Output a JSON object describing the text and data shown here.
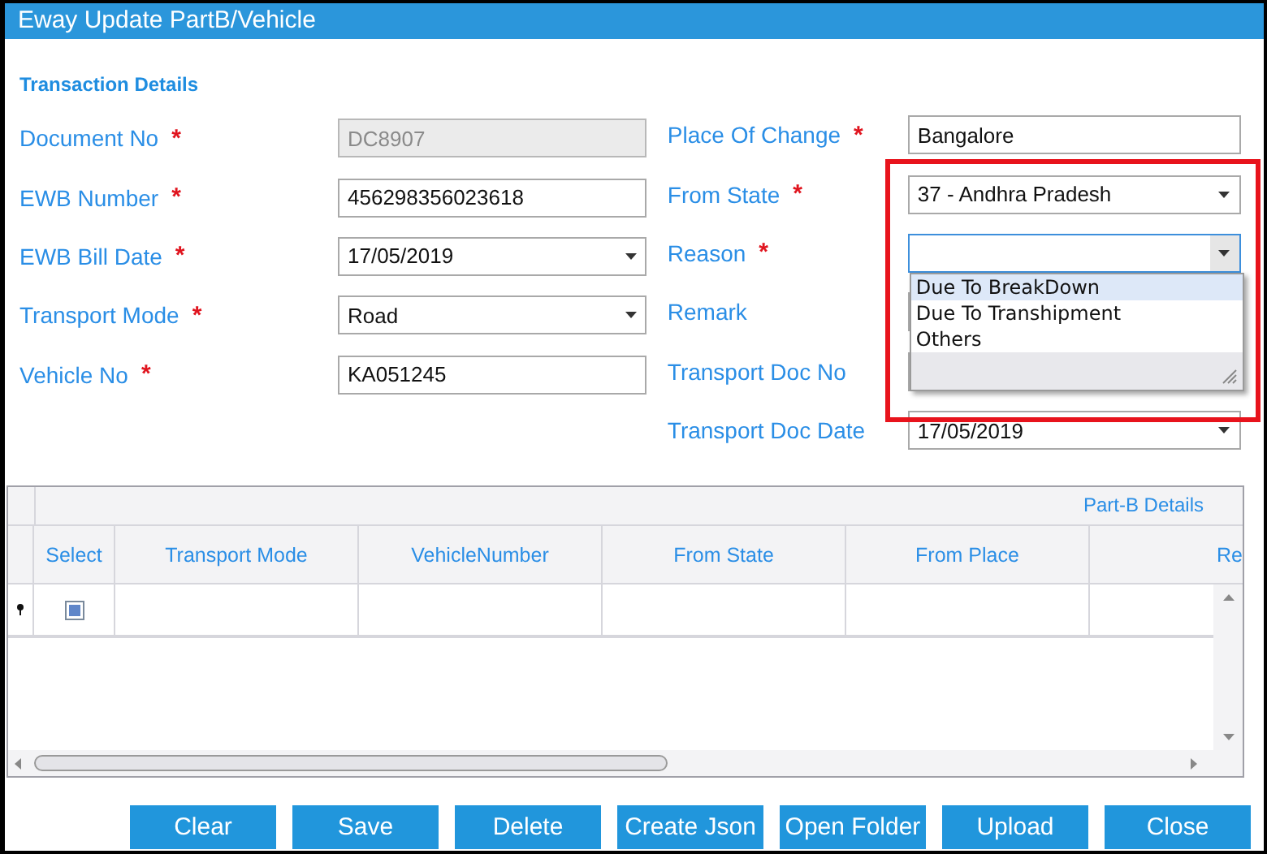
{
  "window": {
    "title": "Eway Update PartB/Vehicle"
  },
  "section_title": "Transaction Details",
  "fields_left": [
    {
      "label": "Document No",
      "required_mark": "*",
      "kind": "text",
      "value": "DC8907",
      "disabled": true
    },
    {
      "label": "EWB Number",
      "required_mark": "*",
      "kind": "text",
      "value": "456298356023618",
      "disabled": false
    },
    {
      "label": "EWB Bill Date",
      "required_mark": "*",
      "kind": "select",
      "value": "17/05/2019",
      "disabled": false
    },
    {
      "label": "Transport Mode",
      "required_mark": "*",
      "kind": "select",
      "value": "Road",
      "disabled": false
    },
    {
      "label": "Vehicle No",
      "required_mark": "*",
      "kind": "text",
      "value": "KA051245",
      "disabled": false
    }
  ],
  "fields_right": [
    {
      "label": "Place Of Change",
      "required_mark": "*",
      "kind": "text",
      "value": "Bangalore",
      "disabled": false
    },
    {
      "label": "From State",
      "required_mark": "*",
      "kind": "select",
      "value": "37 - Andhra Pradesh",
      "disabled": false
    },
    {
      "label": "Reason",
      "required_mark": "*",
      "kind": "select",
      "disabled": false,
      "focused": true,
      "options": [
        {
          "label": "Due To BreakDown",
          "selected": true
        },
        {
          "label": "Due To Transhipment",
          "selected": false
        },
        {
          "label": "Others",
          "selected": false
        }
      ]
    },
    {
      "label": "Remark",
      "kind": "text",
      "disabled": false
    },
    {
      "label": "Transport Doc No",
      "kind": "text",
      "disabled": false
    },
    {
      "label": "Transport Doc Date",
      "kind": "select",
      "value": "17/05/2019",
      "disabled": false
    }
  ],
  "grid": {
    "group_header": "Part-B Details",
    "columns": [
      "Select",
      "Transport Mode",
      "VehicleNumber",
      "From State",
      "From Place",
      "Re"
    ],
    "rows": [
      {
        "cells": [
          "",
          "",
          "",
          "",
          ""
        ]
      }
    ]
  },
  "buttons": [
    "Clear",
    "Save",
    "Delete",
    "Create Json",
    "Open Folder",
    "Upload",
    "Close"
  ]
}
